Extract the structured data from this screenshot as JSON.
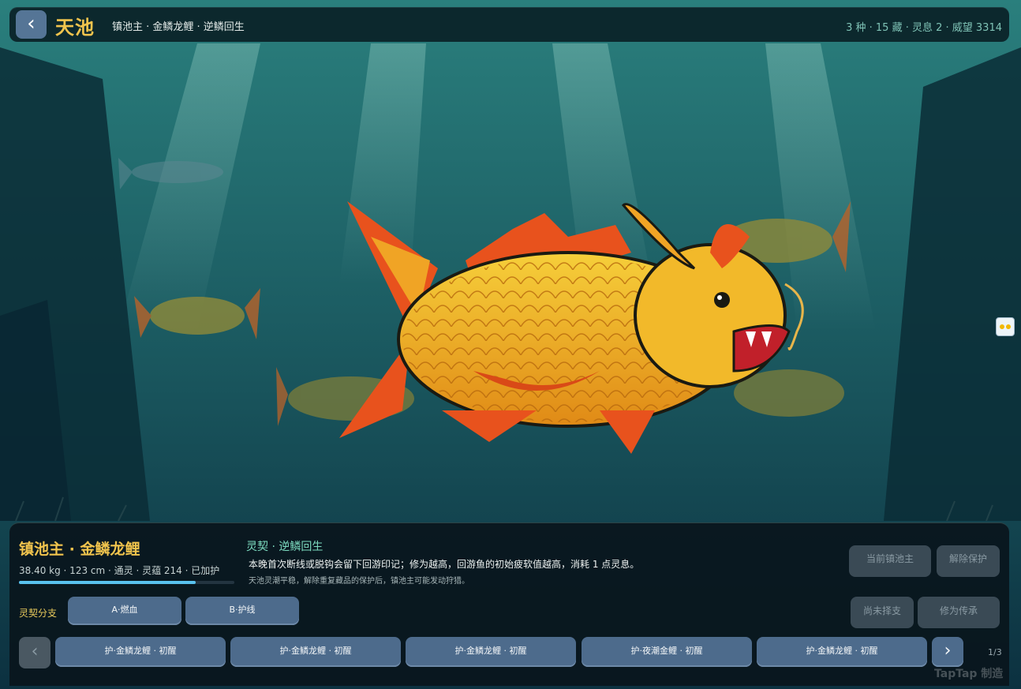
{
  "header": {
    "back_label": "‹",
    "title": "天池",
    "subtitle": "镇池主 · 金鳞龙鲤 · 逆鳞回生",
    "stats": "3 种 · 15 藏 · 灵息 2 · 威望 3314"
  },
  "fish": {
    "name": "镇池主 · 金鳞龙鲤",
    "meta": "38.40 kg · 123 cm · 通灵 · 灵蕴 214 · 已加护",
    "progress": 0.82
  },
  "pact": {
    "title": "灵契 · 逆鳞回生",
    "description": "本晚首次断线或脱钩会留下回游印记；修为越高，回游鱼的初始疲软值越高，消耗 1 点灵息。",
    "note": "天池灵潮平稳，解除重复藏品的保护后，镇池主可能发动狩猎。"
  },
  "actions": {
    "current_master": "当前镇池主",
    "remove_protection": "解除保护",
    "not_chosen": "尚未择支",
    "cultivate": "修为传承"
  },
  "branches": {
    "label": "灵契分支",
    "options": [
      "A·燃血",
      "B·护线"
    ]
  },
  "carousel": {
    "prev": "‹",
    "next": "›",
    "items": [
      "护·金鳞龙鲤 · 初醒",
      "护·金鳞龙鲤 · 初醒",
      "护·金鳞龙鲤 · 初醒",
      "护·夜潮金鲤 · 初醒",
      "护·金鳞龙鲤 · 初醒"
    ],
    "page": "1/3"
  },
  "watermark": "TapTap 制造",
  "colors": {
    "accent_gold": "#f1c44d",
    "water": "#1b5a5e",
    "button_blue": "#4d6b8c",
    "progress": "#59c2ee"
  }
}
